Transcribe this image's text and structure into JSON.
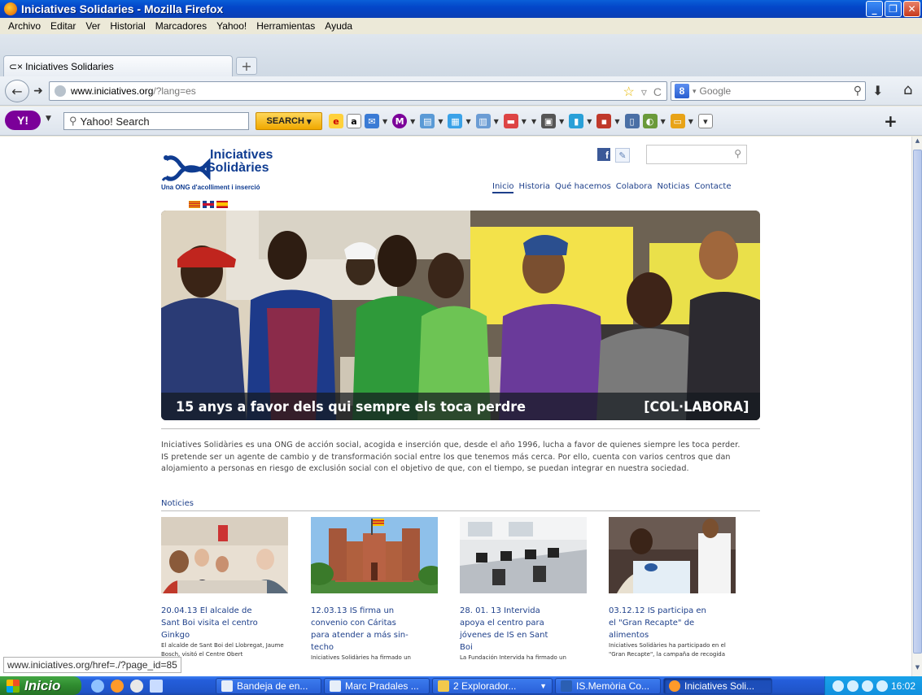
{
  "window": {
    "title": "Iniciatives Solidaries - Mozilla Firefox"
  },
  "menu": [
    "Archivo",
    "Editar",
    "Ver",
    "Historial",
    "Marcadores",
    "Yahoo!",
    "Herramientas",
    "Ayuda"
  ],
  "tab": {
    "label": "Iniciatives Solidaries"
  },
  "nav": {
    "url_domain": "www.iniciatives.org",
    "url_path": "/?lang=es",
    "search_placeholder": "Google"
  },
  "yahoo": {
    "search_placeholder": "Yahoo! Search",
    "search_button": "SEARCH"
  },
  "site": {
    "logo_line1": "Iniciatives",
    "logo_line2": "Solidàries",
    "tagline": "Una ONG d'acolliment i inserció",
    "menu": [
      "Inicio",
      "Historia",
      "Qué hacemos",
      "Colabora",
      "Noticias",
      "Contacte"
    ],
    "hero_caption": "15 anys a favor dels qui sempre els toca perdre",
    "hero_cta": "[COL·LABORA]",
    "intro_1": "Iniciatives Solidàries es una ONG de acción social, acogida e inserción  que, desde el año 1996, lucha a favor de quienes siempre les toca perder.",
    "intro_2": "IS pretende ser un agente de cambio y de transformación social entre los que tenemos más cerca. Por ello, cuenta con varios centros que dan alojamiento a personas en riesgo de exclusión social con el objetivo de que, con el tiempo, se puedan integrar en nuestra sociedad.",
    "news_heading": "Noticies",
    "news": [
      {
        "title": "20.04.13 El alcalde de Sant Boi visita el centro Ginkgo",
        "body": "El alcalde de Sant Boi del Llobregat, Jaume Bosch, visitó el Centre Obert"
      },
      {
        "title": "12.03.13 IS firma un convenio con Cáritas para atender a más sin-techo",
        "body": "Iniciatives Solidàries ha firmado un"
      },
      {
        "title": "28. 01. 13 Intervida apoya el centro para jóvenes de IS en Sant Boi",
        "body": "La Fundación Intervida ha firmado un"
      },
      {
        "title": "03.12.12 IS participa en el \"Gran Recapte\" de alimentos",
        "body": "Iniciatives Solidàries ha participado en el \"Gran Recapte\", la campaña de recogida"
      }
    ]
  },
  "status_url": "www.iniciatives.org/href=./?page_id=85",
  "taskbar": {
    "start": "Inicio",
    "items": [
      "Bandeja de en...",
      "Marc Pradales ...",
      "2 Explorador...",
      "IS.Memòria Co...",
      "Iniciatives Soli..."
    ],
    "clock": "16:02"
  }
}
